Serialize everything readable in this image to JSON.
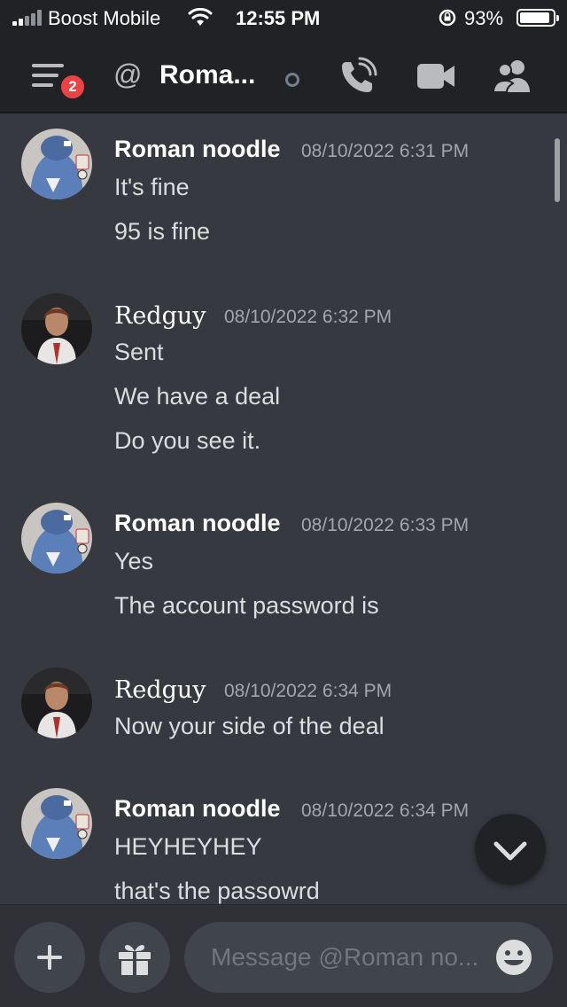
{
  "status_bar": {
    "carrier": "Boost Mobile",
    "time": "12:55 PM",
    "battery": "93%"
  },
  "header": {
    "unread_count": "2",
    "at_symbol": "@",
    "title": "Roma...",
    "icons": [
      "menu-icon",
      "at-icon",
      "status-dot-icon",
      "call-icon",
      "video-icon",
      "members-icon"
    ]
  },
  "messages": [
    {
      "author": "Roman noodle",
      "timestamp": "08/10/2022 6:31 PM",
      "lines": [
        "It's fine",
        "95 is fine"
      ]
    },
    {
      "author": "Redguy",
      "timestamp": "08/10/2022 6:32 PM",
      "lines": [
        "Sent",
        "We have a deal",
        "Do you see it."
      ]
    },
    {
      "author": "Roman noodle",
      "timestamp": "08/10/2022 6:33 PM",
      "lines": [
        "Yes",
        "The account password is"
      ]
    },
    {
      "author": "Redguy",
      "timestamp": "08/10/2022 6:34 PM",
      "lines": [
        "Now your side of the deal"
      ]
    },
    {
      "author": "Roman noodle",
      "timestamp": "08/10/2022 6:34 PM",
      "lines": [
        "HEYHEYHEY",
        "that's the passowrd"
      ]
    }
  ],
  "composer": {
    "placeholder": "Message @Roman no..."
  },
  "colors": {
    "background": "#36393f",
    "header": "#202225",
    "badge": "#ed4245",
    "input": "#40444b"
  }
}
